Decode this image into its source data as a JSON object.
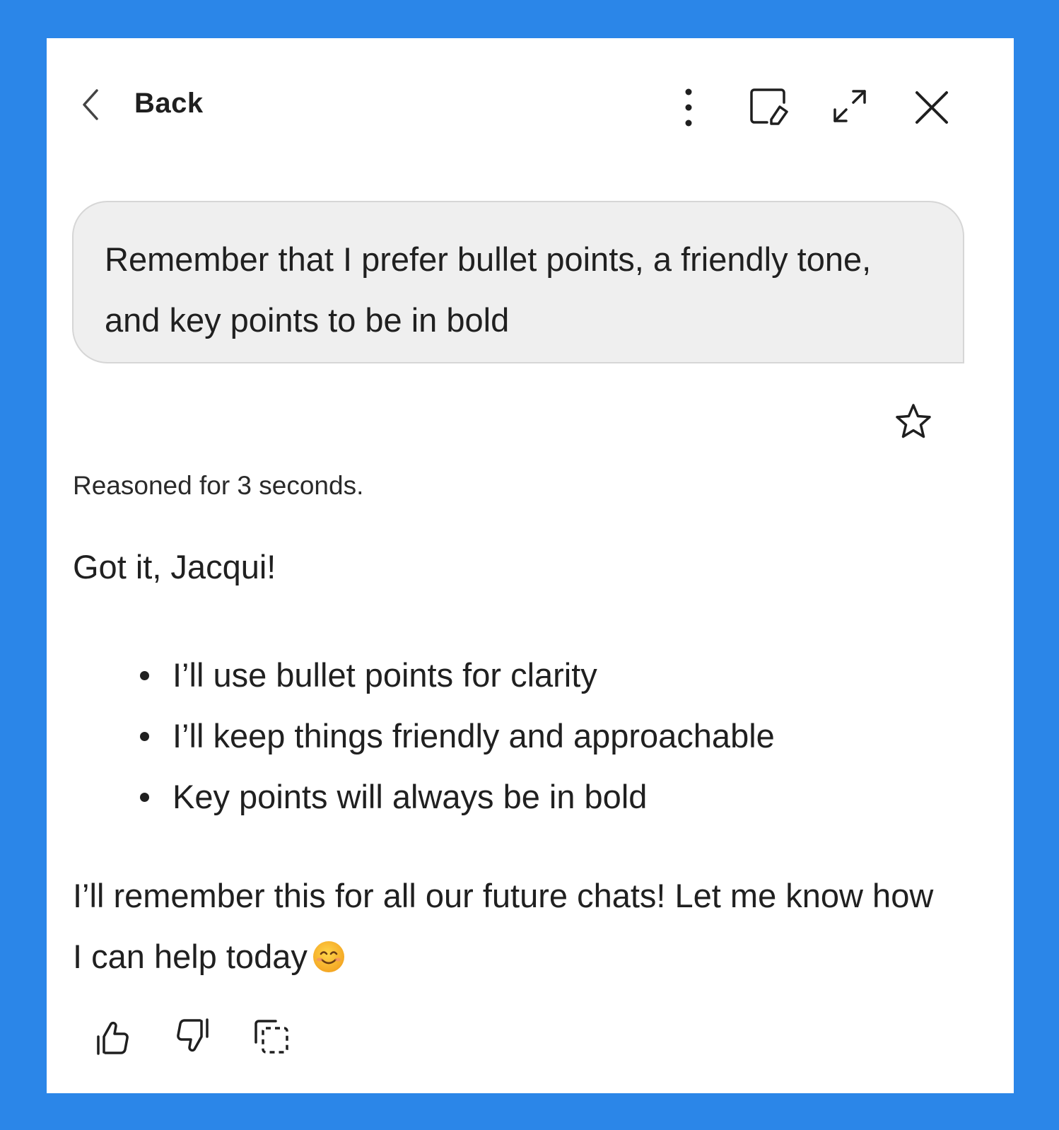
{
  "header": {
    "back_label": "Back",
    "icons": [
      "chevron-left-icon",
      "more-vertical-icon",
      "edit-note-icon",
      "expand-icon",
      "close-icon"
    ]
  },
  "user_message": {
    "text": "Remember that I prefer bullet points, a friendly tone, and key points to be in bold"
  },
  "assistant": {
    "reasoning_status": "Reasoned for 3 seconds.",
    "greeting": "Got it, Jacqui!",
    "bullets": [
      "I’ll use bullet points for clarity",
      "I’ll keep things friendly and approachable",
      "Key points will always be in bold"
    ],
    "closing": "I’ll remember this for all our future chats! Let me know how I can help today"
  },
  "feedback": {
    "icons": [
      "thumbs-up-icon",
      "thumbs-down-icon",
      "copy-icon"
    ]
  },
  "colors": {
    "frame_background": "#2b86e8",
    "panel_background": "#ffffff",
    "user_bubble_background": "#efefef",
    "text": "#202020"
  }
}
